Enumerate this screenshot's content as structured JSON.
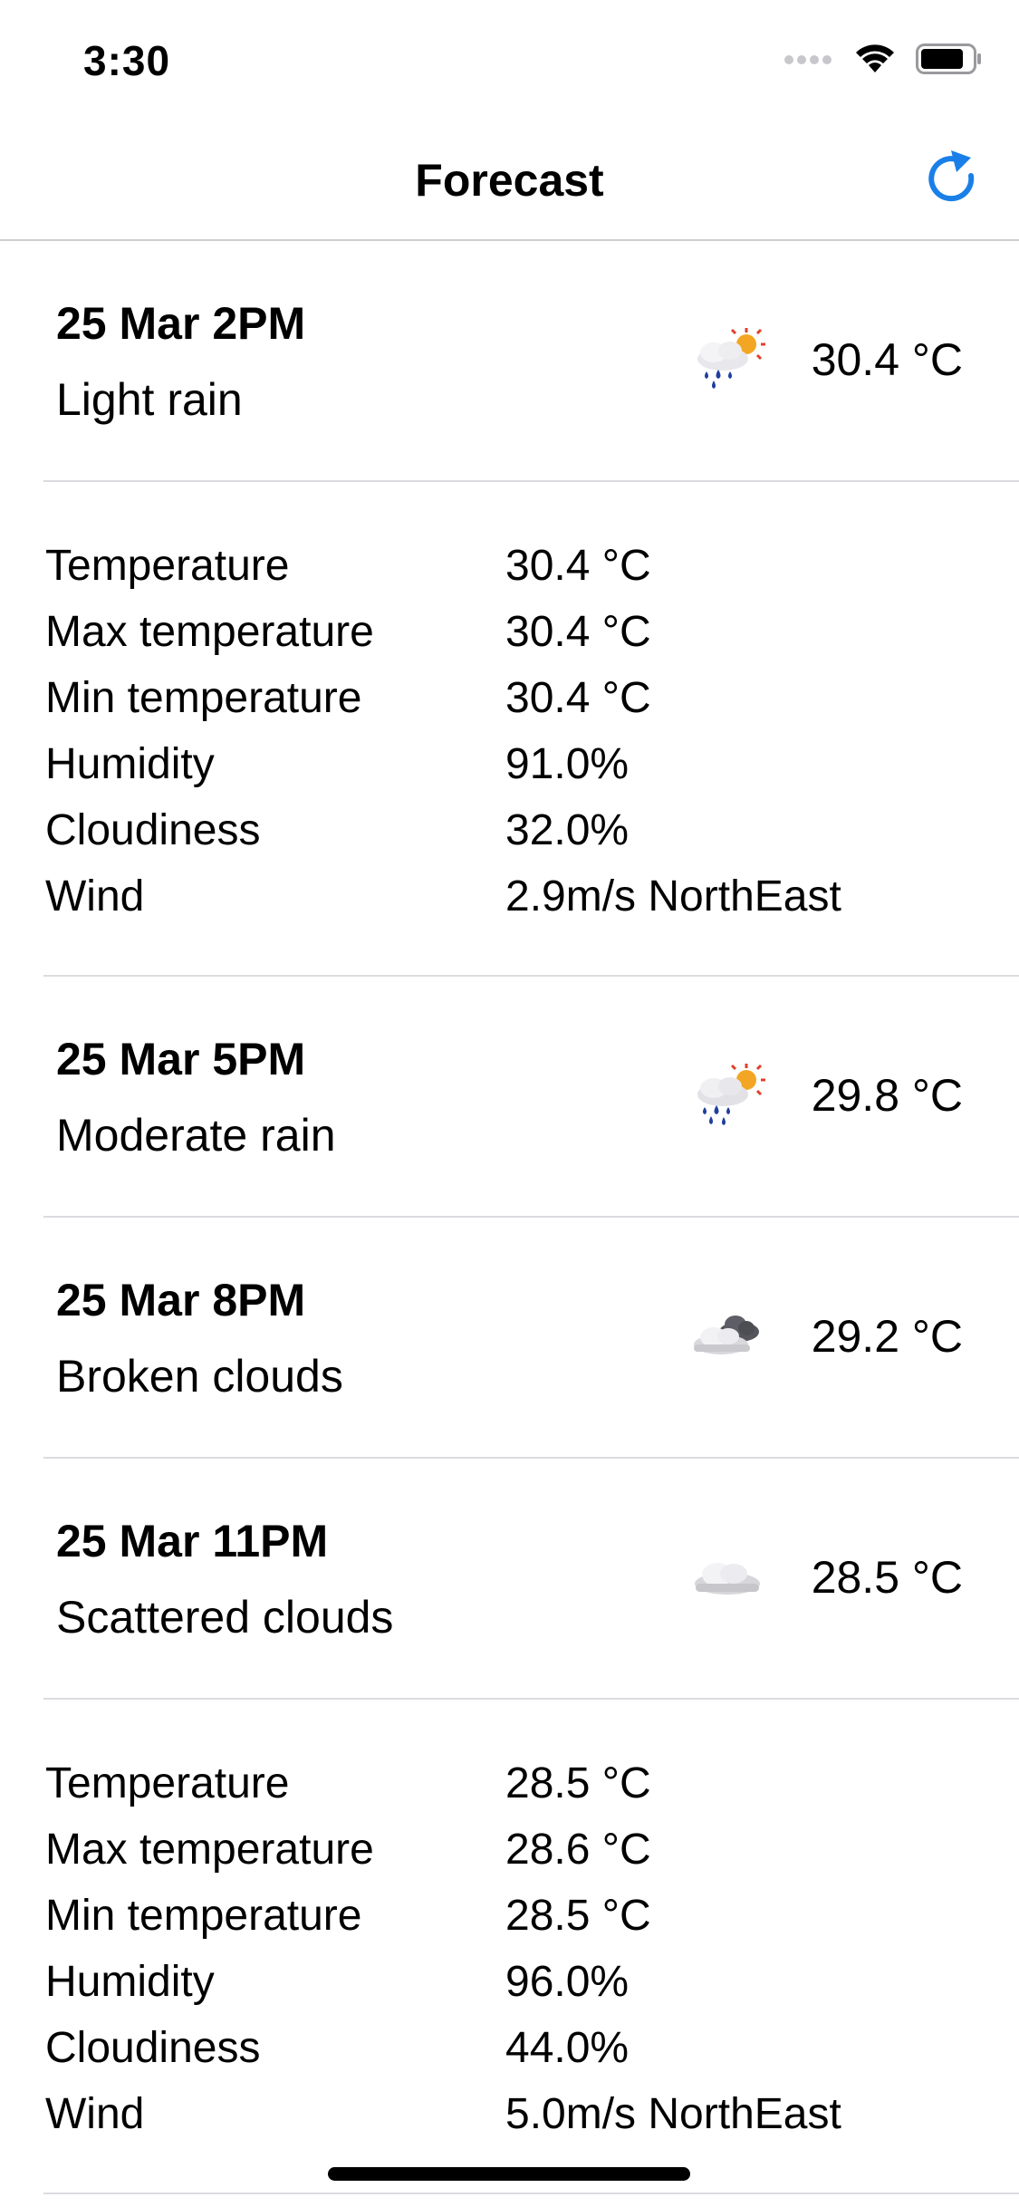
{
  "status": {
    "time": "3:30"
  },
  "nav": {
    "title": "Forecast",
    "refresh_icon": "refresh-icon"
  },
  "colors": {
    "accent": "#1a7fe8",
    "separator": "#dcdce0",
    "rain_drop": "#1f3f9e",
    "sun": "#f3a623"
  },
  "forecasts": [
    {
      "date": "25 Mar 2PM",
      "description": "Light rain",
      "temp": "30.4 °C",
      "icon": "light-rain-sun-icon",
      "details": [
        {
          "label": "Temperature",
          "value": "30.4 °C"
        },
        {
          "label": "Max temperature",
          "value": "30.4 °C"
        },
        {
          "label": "Min temperature",
          "value": "30.4 °C"
        },
        {
          "label": "Humidity",
          "value": "91.0%"
        },
        {
          "label": "Cloudiness",
          "value": "32.0%"
        },
        {
          "label": "Wind",
          "value": "2.9m/s NorthEast"
        }
      ]
    },
    {
      "date": "25 Mar 5PM",
      "description": "Moderate rain",
      "temp": "29.8 °C",
      "icon": "moderate-rain-sun-icon"
    },
    {
      "date": "25 Mar 8PM",
      "description": "Broken clouds",
      "temp": "29.2 °C",
      "icon": "broken-clouds-icon"
    },
    {
      "date": "25 Mar 11PM",
      "description": "Scattered clouds",
      "temp": "28.5 °C",
      "icon": "scattered-clouds-icon",
      "details": [
        {
          "label": "Temperature",
          "value": "28.5 °C"
        },
        {
          "label": "Max temperature",
          "value": "28.6 °C"
        },
        {
          "label": "Min temperature",
          "value": "28.5 °C"
        },
        {
          "label": "Humidity",
          "value": "96.0%"
        },
        {
          "label": "Cloudiness",
          "value": "44.0%"
        },
        {
          "label": "Wind",
          "value": "5.0m/s NorthEast"
        }
      ]
    }
  ]
}
